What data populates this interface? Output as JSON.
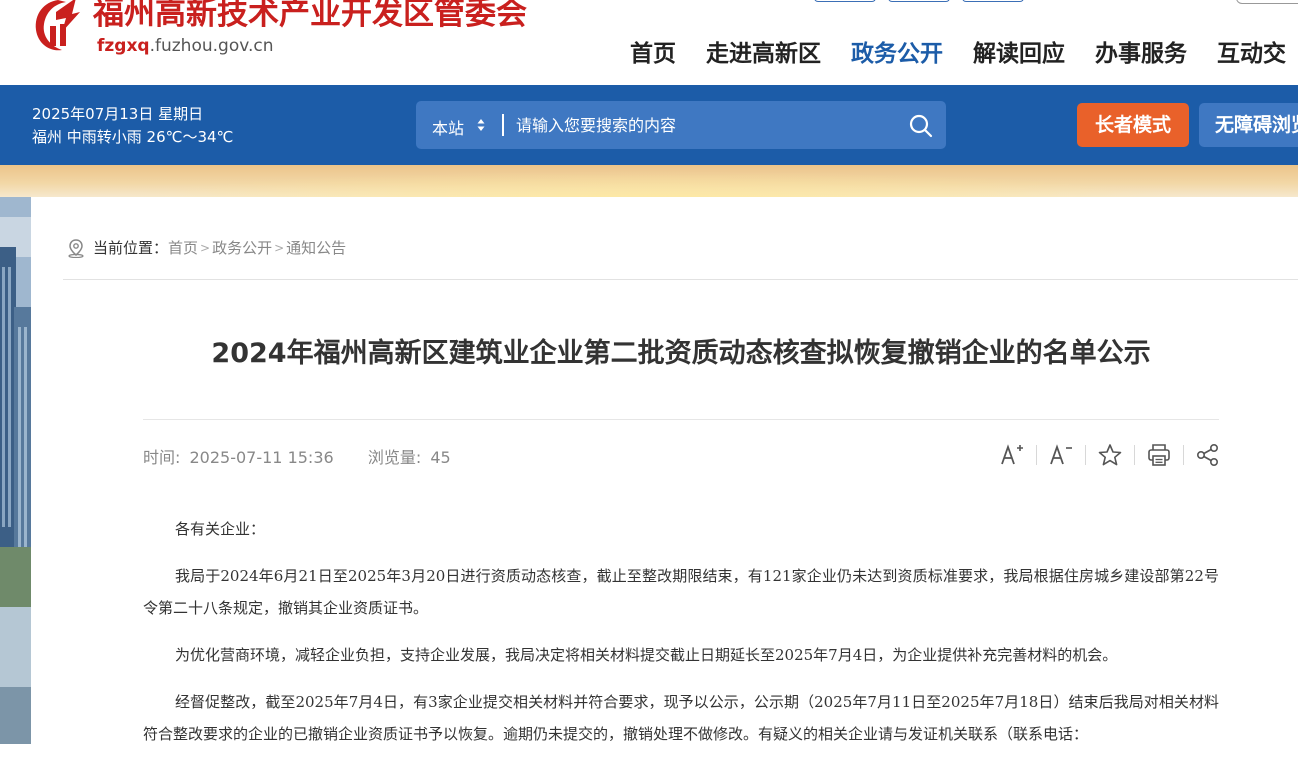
{
  "header": {
    "site_name": "福州高新技术产业开发区管委会",
    "domain_prefix": "fzgxq",
    "domain_rest": ".fuzhou.gov.cn",
    "brand_color": "#c9201e",
    "nav": [
      {
        "label": "首页",
        "active": false
      },
      {
        "label": "走进高新区",
        "active": false
      },
      {
        "label": "政务公开",
        "active": true
      },
      {
        "label": "解读回应",
        "active": false
      },
      {
        "label": "办事服务",
        "active": false
      },
      {
        "label": "互动交",
        "active": false
      }
    ]
  },
  "bar": {
    "date_line": "2025年07月13日 星期日",
    "weather_line": "福州 中雨转小雨 26℃～34℃",
    "search_scope": "本站",
    "search_placeholder": "请输入您要搜索的内容",
    "elder_mode": "长者模式",
    "accessibility": "无障碍浏览",
    "bar_color": "#1c5ca8",
    "elder_color": "#e9612a"
  },
  "breadcrumb": {
    "label": "当前位置：",
    "items": [
      "首页",
      "政务公开",
      "通知公告"
    ],
    "separator": ">"
  },
  "article": {
    "title": "2024年福州高新区建筑业企业第二批资质动态核查拟恢复撤销企业的名单公示",
    "time_label": "时间:",
    "time_value": "2025-07-11 15:36",
    "views_label": "浏览量:",
    "views_value": "45",
    "tools": [
      "font-increase-icon",
      "font-decrease-icon",
      "favorite-star-icon",
      "print-icon",
      "share-icon"
    ],
    "paragraphs": [
      "各有关企业：",
      "我局于2024年6月21日至2025年3月20日进行资质动态核查，截止至整改期限结束，有121家企业仍未达到资质标准要求，我局根据住房城乡建设部第22号令第二十八条规定，撤销其企业资质证书。",
      "为优化营商环境，减轻企业负担，支持企业发展，我局决定将相关材料提交截止日期延长至2025年7月4日，为企业提供补充完善材料的机会。",
      "经督促整改，截至2025年7月4日，有3家企业提交相关材料并符合要求，现予以公示，公示期（2025年7月11日至2025年7月18日）结束后我局对相关材料符合整改要求的企业的已撤销企业资质证书予以恢复。逾期仍未提交的，撤销处理不做修改。有疑义的相关企业请与发证机关联系（联系电话："
    ]
  }
}
